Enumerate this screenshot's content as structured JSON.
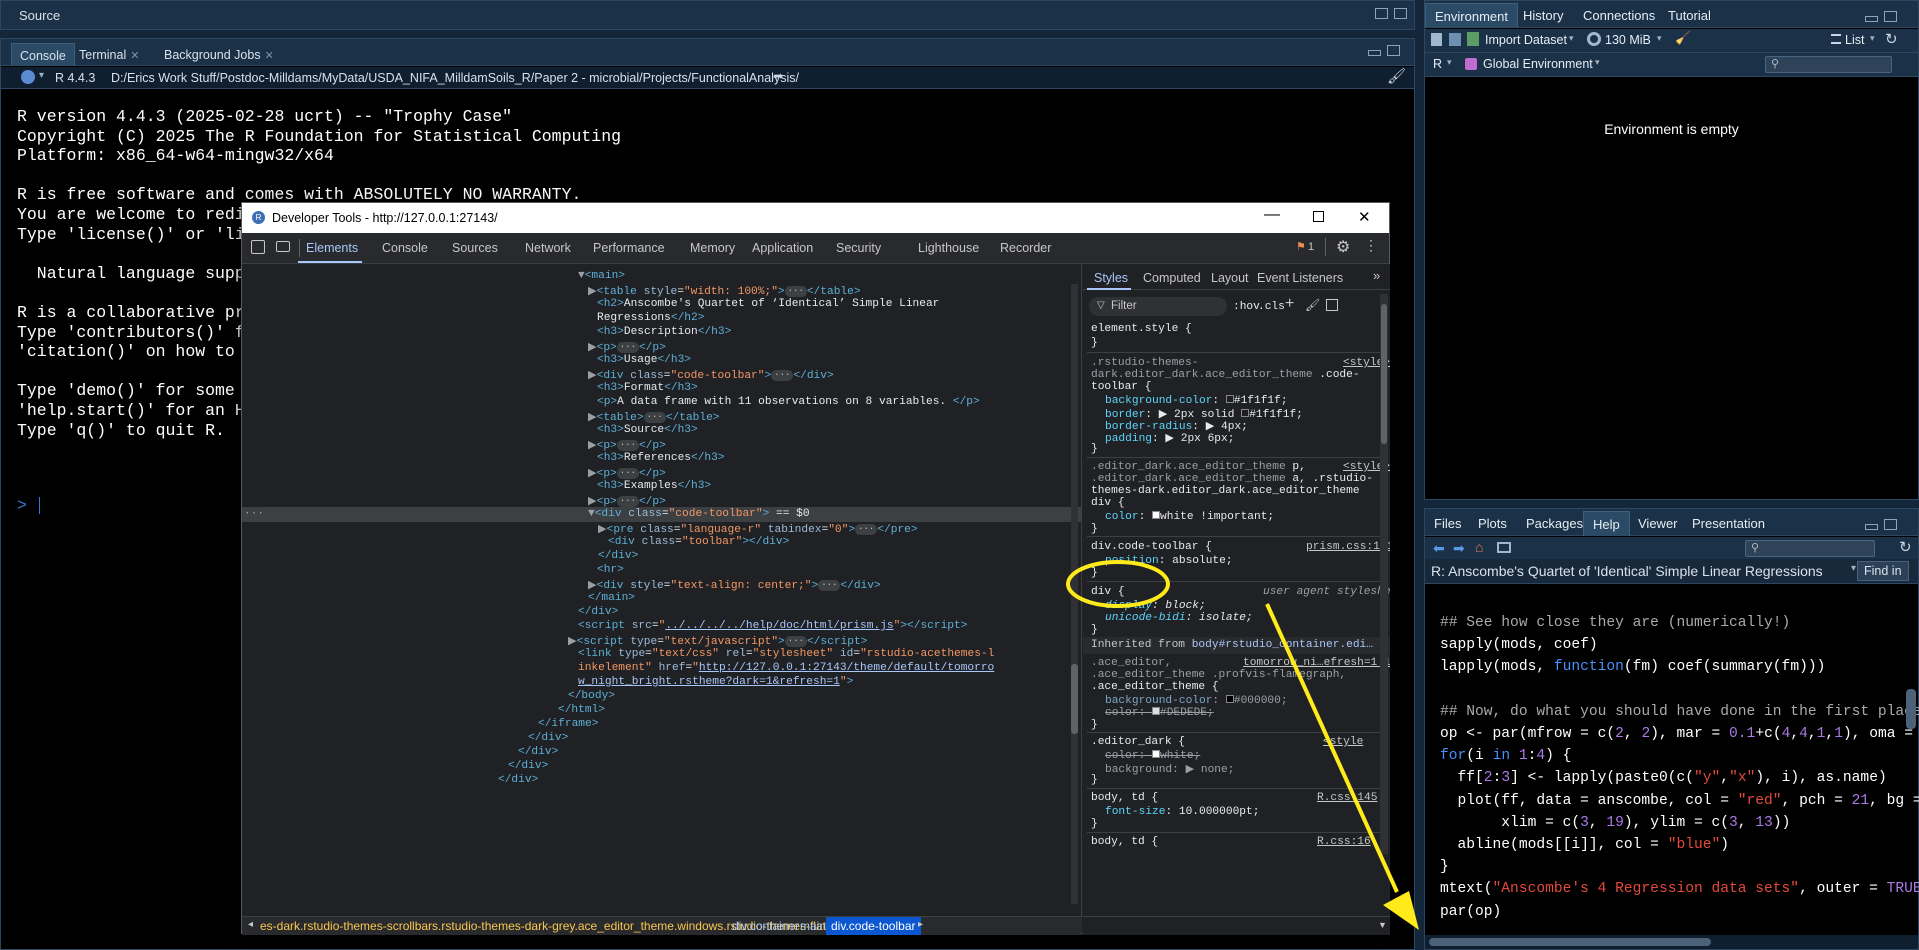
{
  "source_pane": {
    "title": "Source"
  },
  "console": {
    "tabs": [
      {
        "label": "Console"
      },
      {
        "label": "Terminal"
      },
      {
        "label": "Background Jobs"
      }
    ],
    "r_version": "R 4.4.3",
    "path": "D:/Erics Work Stuff/Postdoc-Milldams/MyData/USDA_NIFA_MilldamSoils_R/Paper 2 - microbial/Projects/FunctionalAnalysis/",
    "lines": [
      "R version 4.4.3 (2025-02-28 ucrt) -- \"Trophy Case\"",
      "Copyright (C) 2025 The R Foundation for Statistical Computing",
      "Platform: x86_64-w64-mingw32/x64",
      "",
      "R is free software and comes with ABSOLUTELY NO WARRANTY.",
      "You are welcome to redi",
      "Type 'license()' or 'li",
      "",
      "  Natural language suppo",
      "",
      "R is a collaborative pro",
      "Type 'contributors()' fo",
      "'citation()' on how to c",
      "",
      "Type 'demo()' for some c",
      "'help.start()' for an HT",
      "Type 'q()' to quit R."
    ],
    "prompt": ">"
  },
  "env_pane": {
    "tabs": [
      {
        "label": "Environment"
      },
      {
        "label": "History"
      },
      {
        "label": "Connections"
      },
      {
        "label": "Tutorial"
      }
    ],
    "import_label": "Import Dataset",
    "memory": "130 MiB",
    "view_mode": "List",
    "language": "R",
    "scope": "Global Environment",
    "empty_message": "Environment is empty"
  },
  "help_pane": {
    "tabs": [
      {
        "label": "Files"
      },
      {
        "label": "Plots"
      },
      {
        "label": "Packages"
      },
      {
        "label": "Help"
      },
      {
        "label": "Viewer"
      },
      {
        "label": "Presentation"
      }
    ],
    "title": "R: Anscombe's Quartet of 'Identical' Simple Linear Regressions",
    "find_label": "Find in"
  },
  "devtools": {
    "title": "Developer Tools - http://127.0.0.1:27143/",
    "issues_count": "1",
    "tabs": [
      "Elements",
      "Console",
      "Sources",
      "Network",
      "Performance",
      "Memory",
      "Application",
      "Security",
      "Lighthouse",
      "Recorder"
    ],
    "styles_tabs": [
      "Styles",
      "Computed",
      "Layout",
      "Event Listeners"
    ],
    "filter_placeholder": "Filter",
    "hov": ":hov",
    "cls": ".cls",
    "breadcrumbs": [
      "es-dark.rstudio-themes-scrollbars.rstudio-themes-dark-grey.ace_editor_theme.windows.rstudio-themes-flat",
      "div.container",
      "main",
      "div.code-toolbar"
    ]
  },
  "colors": {
    "annotation": "#ffeb1a",
    "accent": "#a8c7fa"
  }
}
